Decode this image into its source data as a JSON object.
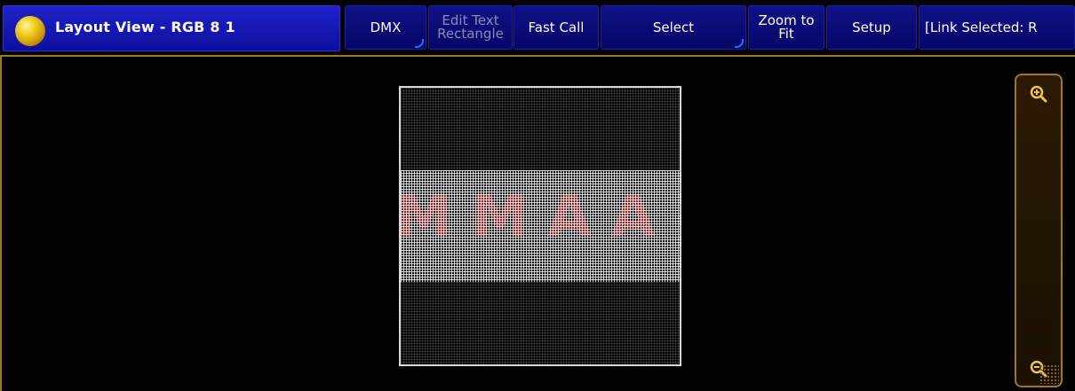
{
  "window": {
    "title": "Layout View - RGB 8 1"
  },
  "toolbar": {
    "dmx": "DMX",
    "edit_text_rectangle": [
      "Edit Text",
      "Rectangle"
    ],
    "fast_call": "Fast Call",
    "select": "Select",
    "zoom_to_fit": [
      "Zoom to",
      "Fit"
    ],
    "setup": "Setup",
    "link_selected": "[Link Selected: R"
  },
  "stage": {
    "content_text": "MMAA"
  },
  "icons": {
    "title": "ball-icon",
    "zoom_in": "zoom-in-icon",
    "zoom_out": "zoom-out-icon"
  },
  "colors": {
    "title_bg": "#1f22c9",
    "button_bg": "#0f1186",
    "accent_border": "#a27818",
    "content_bg": "#000000",
    "text_red": "#8a1518"
  }
}
